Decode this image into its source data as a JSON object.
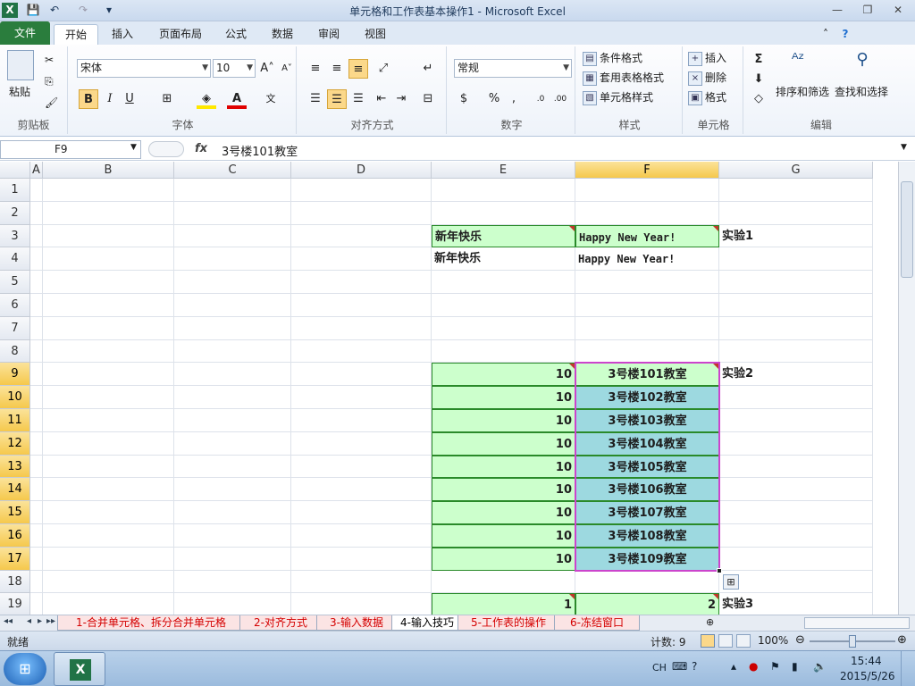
{
  "window": {
    "title": "单元格和工作表基本操作1  -  Microsoft Excel",
    "qa_save": "💾",
    "qa_undo": "↶",
    "qa_redo": "↷",
    "qa_more": "▾",
    "min": "—",
    "max": "❐",
    "close": "✕"
  },
  "tabs": [
    {
      "label": "文件"
    },
    {
      "label": "开始"
    },
    {
      "label": "插入"
    },
    {
      "label": "页面布局"
    },
    {
      "label": "公式"
    },
    {
      "label": "数据"
    },
    {
      "label": "审阅"
    },
    {
      "label": "视图"
    }
  ],
  "ribbon": {
    "clipboard": {
      "label": "剪贴板",
      "paste": "粘贴"
    },
    "font": {
      "label": "字体",
      "name": "宋体",
      "size": "10",
      "bold": "B",
      "italic": "I",
      "underline": "U",
      "grow": "A˄",
      "shrink": "A˅"
    },
    "align": {
      "label": "对齐方式"
    },
    "number": {
      "label": "数字",
      "format": "常规",
      "percent": "%",
      "comma": ","
    },
    "styles": {
      "label": "样式",
      "cond": "条件格式",
      "table": "套用表格格式",
      "cell": "单元格样式"
    },
    "cells": {
      "label": "单元格",
      "insert": "插入",
      "delete": "删除",
      "format": "格式"
    },
    "edit": {
      "label": "编辑",
      "sum": "Σ",
      "sort": "排序和筛选",
      "find": "查找和选择"
    }
  },
  "formula": {
    "namebox": "F9",
    "fx": "fx",
    "content": "3号楼101教室"
  },
  "grid": {
    "columns": [
      "A",
      "B",
      "C",
      "D",
      "E",
      "F",
      "G"
    ],
    "rows": [
      "1",
      "2",
      "3",
      "4",
      "5",
      "6",
      "7",
      "8",
      "9",
      "10",
      "11",
      "12",
      "13",
      "14",
      "15",
      "16",
      "17",
      "18",
      "19"
    ],
    "active_col": "F",
    "active_rows": [
      "9",
      "10",
      "11",
      "12",
      "13",
      "14",
      "15",
      "16",
      "17"
    ],
    "cells": [
      {
        "col": "E",
        "row": "3",
        "text": "新年快乐",
        "style": "green",
        "tri": true
      },
      {
        "col": "F",
        "row": "3",
        "text": "Happy New Year!",
        "style": "green mono",
        "tri": true
      },
      {
        "col": "G",
        "row": "3",
        "text": "实验1"
      },
      {
        "col": "E",
        "row": "4",
        "text": "新年快乐"
      },
      {
        "col": "F",
        "row": "4",
        "text": "Happy New Year!",
        "style": "mono"
      },
      {
        "col": "E",
        "row": "9",
        "text": "10",
        "style": "green r",
        "tri": true
      },
      {
        "col": "F",
        "row": "9",
        "text": "3号楼101教室",
        "style": "green c",
        "tri": true
      },
      {
        "col": "G",
        "row": "9",
        "text": "实验2"
      },
      {
        "col": "E",
        "row": "10",
        "text": "10",
        "style": "green r"
      },
      {
        "col": "F",
        "row": "10",
        "text": "3号楼102教室",
        "style": "cyan c"
      },
      {
        "col": "E",
        "row": "11",
        "text": "10",
        "style": "green r"
      },
      {
        "col": "F",
        "row": "11",
        "text": "3号楼103教室",
        "style": "cyan c"
      },
      {
        "col": "E",
        "row": "12",
        "text": "10",
        "style": "green r"
      },
      {
        "col": "F",
        "row": "12",
        "text": "3号楼104教室",
        "style": "cyan c"
      },
      {
        "col": "E",
        "row": "13",
        "text": "10",
        "style": "green r"
      },
      {
        "col": "F",
        "row": "13",
        "text": "3号楼105教室",
        "style": "cyan c"
      },
      {
        "col": "E",
        "row": "14",
        "text": "10",
        "style": "green r"
      },
      {
        "col": "F",
        "row": "14",
        "text": "3号楼106教室",
        "style": "cyan c"
      },
      {
        "col": "E",
        "row": "15",
        "text": "10",
        "style": "green r"
      },
      {
        "col": "F",
        "row": "15",
        "text": "3号楼107教室",
        "style": "cyan c"
      },
      {
        "col": "E",
        "row": "16",
        "text": "10",
        "style": "green r"
      },
      {
        "col": "F",
        "row": "16",
        "text": "3号楼108教室",
        "style": "cyan c"
      },
      {
        "col": "E",
        "row": "17",
        "text": "10",
        "style": "green r"
      },
      {
        "col": "F",
        "row": "17",
        "text": "3号楼109教室",
        "style": "cyan c"
      },
      {
        "col": "E",
        "row": "19",
        "text": "1",
        "style": "green r",
        "tri": true
      },
      {
        "col": "F",
        "row": "19",
        "text": "2",
        "style": "green r",
        "tri": true
      },
      {
        "col": "G",
        "row": "19",
        "text": "实验3"
      }
    ],
    "selection": {
      "from_col": "F",
      "from_row": "9",
      "to_col": "F",
      "to_row": "17"
    },
    "autofill_icon": "⊞"
  },
  "sheets": [
    {
      "label": "1-合并单元格、拆分合并单元格"
    },
    {
      "label": "2-对齐方式"
    },
    {
      "label": "3-输入数据"
    },
    {
      "label": "4-输入技巧",
      "active": true
    },
    {
      "label": "5-工作表的操作"
    },
    {
      "label": "6-冻结窗口"
    }
  ],
  "status": {
    "ready": "就绪",
    "count": "计数: 9",
    "zoom": "100%"
  },
  "taskbar": {
    "lang": "CH",
    "time": "15:44",
    "date": "2015/5/26"
  },
  "colors": {
    "file_tab": "#2a7d3d",
    "header_sel": "#f5c84c",
    "green_fill": "#ccffcc",
    "cyan_fill": "#9dd9e0",
    "sheet_text": "#d40000"
  }
}
